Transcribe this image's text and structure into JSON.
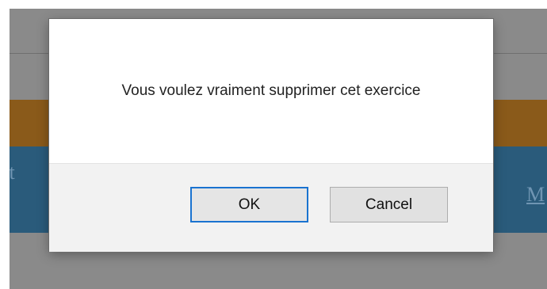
{
  "background": {
    "left_text_fragment": "et",
    "right_link_fragment": "M"
  },
  "dialog": {
    "message": "Vous voulez vraiment supprimer cet exercice",
    "ok_label": "OK",
    "cancel_label": "Cancel"
  },
  "colors": {
    "overlay": "#8a8a8a",
    "background_orange_band": "#8a5a1a",
    "background_blue_band": "#2a5b7b",
    "ok_focus_border": "#1a73d0"
  }
}
